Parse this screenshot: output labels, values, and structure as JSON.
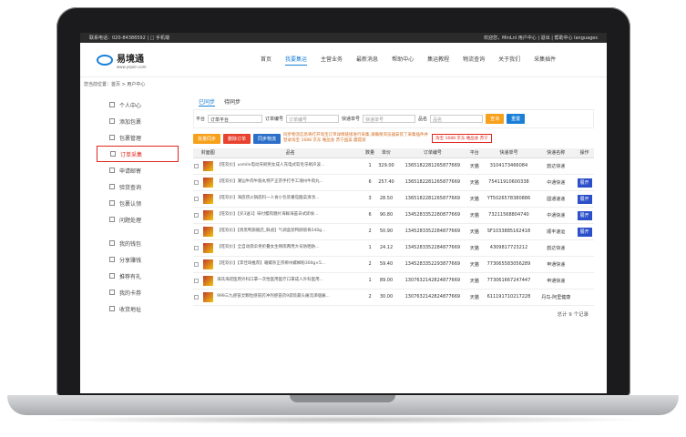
{
  "topbar": {
    "left": "联系电话：020-84386592 | □ 手机端",
    "right": "欢迎您，MinLnl 用户中心 | 退出 | 帮助中心 languages"
  },
  "logo": {
    "name": "易境通",
    "url": "www.yejoin.com"
  },
  "nav": [
    "首页",
    "我要集运",
    "主营业务",
    "最新消息",
    "帮助中心",
    "集运教程",
    "物流查询",
    "关于我们",
    "采集插件"
  ],
  "breadcrumb": "您当前位置：首页 > 用户中心",
  "sidebar": [
    "个人中心",
    "添加包裹",
    "包裹管理",
    "订单采集",
    "申请邮寄",
    "验货查询",
    "包裹认领",
    "问题处理",
    "我的钱包",
    "分享赚钱",
    "推荐有礼",
    "我的卡券",
    "收货地址"
  ],
  "tabs": [
    "已同步",
    "待同步"
  ],
  "filter": {
    "platform_label": "平台",
    "platform_value": "订单平台",
    "order_label": "订单编号",
    "order_ph": "订单编号",
    "express_label": "快递单号",
    "express_ph": "快递单号",
    "name_label": "品名",
    "name_ph": "品名",
    "search": "查询",
    "reset": "重置"
  },
  "tools": {
    "b1": "批量同步",
    "b2": "删除订单",
    "b3": "同步物流",
    "note": "同步物流信息将打开淘宝订单详情链接进行采集,请确保浏览器安装了采集插件并登录淘宝 1688 京东 唯品会 苏宁国美 蘑菇街",
    "highlight": "淘宝 1688 京东 唯品会 苏宁"
  },
  "table": {
    "headers": [
      "",
      "封面图",
      "品名",
      "数量",
      "单价",
      "订单编号",
      "平台",
      "快递单号",
      "快递名称",
      "操作"
    ],
    "rows": [
      {
        "name": "【旺欢价】usmile电动牙刷男女成人充电式软毛牙刷声波...",
        "qty": "1",
        "price": "329.00",
        "order": "1365182281265877669",
        "platform": "天猫",
        "express": "3104173466084",
        "courier": "韵达快递",
        "op": ""
      },
      {
        "name": "【旺欢价】潮汕牛肉牛筋丸特产正宗手打手工潮州牛肉丸...",
        "qty": "6",
        "price": "257.40",
        "order": "1365182281265877669",
        "platform": "天猫",
        "express": "75411910600338",
        "courier": "中通快递",
        "op": "展开"
      },
      {
        "name": "【旺欢价】海底捞火锅底料一人食小包装番茄酸菜清汤...",
        "qty": "3",
        "price": "28.50",
        "order": "1365182281265877669",
        "platform": "天猫",
        "express": "YT5026578380886",
        "courier": "圆通速递",
        "op": "展开"
      },
      {
        "name": "【旺欢价】【买3送1】味付樱肉糖片海鲜海苔日式即食...",
        "qty": "6",
        "price": "90.80",
        "order": "1345283352280877669",
        "platform": "天猫",
        "express": "73211568804740",
        "courier": "中通快递",
        "op": "展开"
      },
      {
        "name": "【旺欢价】【周黑鸭旗舰店_鲜卤】气调盒装鸭脖锁骨240g...",
        "qty": "2",
        "price": "50.90",
        "order": "1345283352284877669",
        "platform": "天猫",
        "express": "SF1033885162418",
        "courier": "顺丰速运",
        "op": "展开"
      },
      {
        "name": "【旺欢价】全自动雨伞男折叠女生晴雨两用大号防晒防...",
        "qty": "1",
        "price": "24.12",
        "order": "1345283352284877669",
        "platform": "天猫",
        "express": "4309817723212",
        "courier": "韵达快递",
        "op": ""
      },
      {
        "name": "【旺欢价】【李佳琦推荐】箱螺杂正宗柳州螺蛳粉300g×5...",
        "qty": "2",
        "price": "59.40",
        "order": "1345283352293877669",
        "platform": "天猫",
        "express": "773065583056289",
        "courier": "申通快递",
        "op": ""
      },
      {
        "name": "海氏海诺医用外科口罩一次性医用医疗口罩成人外科医用...",
        "qty": "1",
        "price": "89.00",
        "order": "1307632142824877669",
        "platform": "天猫",
        "express": "773061667247447",
        "courier": "申通快递",
        "op": ""
      },
      {
        "name": "999三九感冒灵颗粒感冒药冲剂感冒药9袋装最头痛流涕咽痛...",
        "qty": "2",
        "price": "30.00",
        "order": "1307632142824877669",
        "platform": "天猫",
        "express": "611191710217228",
        "courier": "丹鸟-阿里健康",
        "op": ""
      }
    ]
  },
  "total": "总计 9 个记录"
}
